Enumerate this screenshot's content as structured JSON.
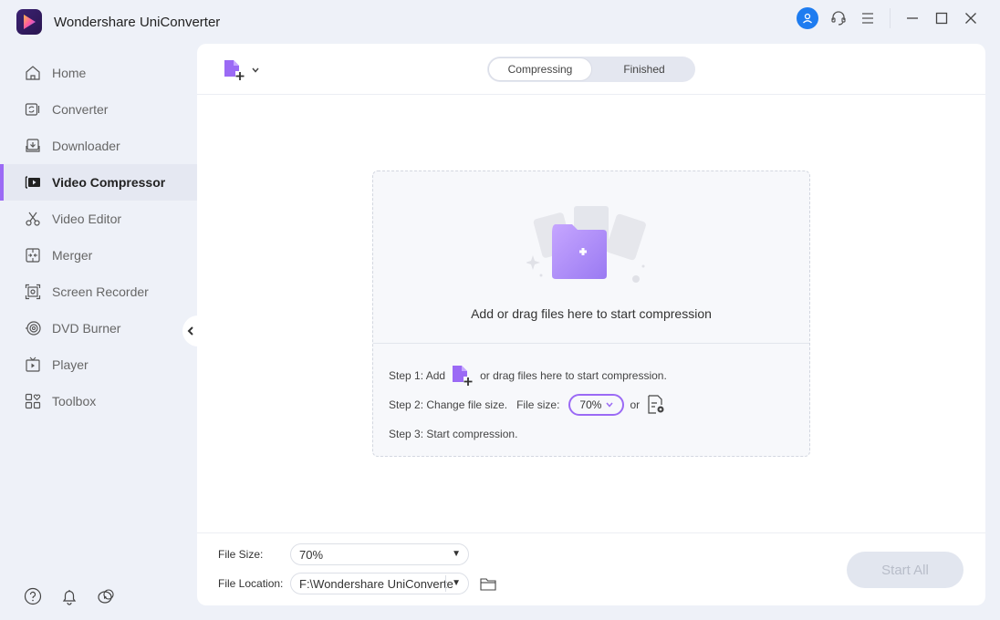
{
  "app": {
    "title": "Wondershare UniConverter",
    "logo_icon": "uniconverter-logo-icon"
  },
  "window_controls": {
    "account_icon": "user-icon",
    "support_icon": "headset-icon",
    "menu_icon": "hamburger-menu-icon",
    "minimize_icon": "minimize-icon",
    "maximize_icon": "maximize-icon",
    "close_icon": "close-icon"
  },
  "sidebar": {
    "items": [
      {
        "label": "Home",
        "icon": "home-icon",
        "active": false
      },
      {
        "label": "Converter",
        "icon": "converter-icon",
        "active": false
      },
      {
        "label": "Downloader",
        "icon": "downloader-icon",
        "active": false
      },
      {
        "label": "Video Compressor",
        "icon": "video-compressor-icon",
        "active": true
      },
      {
        "label": "Video Editor",
        "icon": "scissors-icon",
        "active": false
      },
      {
        "label": "Merger",
        "icon": "merger-icon",
        "active": false
      },
      {
        "label": "Screen Recorder",
        "icon": "screen-recorder-icon",
        "active": false
      },
      {
        "label": "DVD Burner",
        "icon": "dvd-icon",
        "active": false
      },
      {
        "label": "Player",
        "icon": "player-icon",
        "active": false
      },
      {
        "label": "Toolbox",
        "icon": "toolbox-icon",
        "active": false
      }
    ],
    "bottom_icons": [
      "help-icon",
      "bell-icon",
      "community-icon"
    ]
  },
  "main": {
    "tabs": [
      {
        "label": "Compressing",
        "active": true
      },
      {
        "label": "Finished",
        "active": false
      }
    ],
    "dropzone": {
      "text": "Add or drag files here to start compression"
    },
    "steps": {
      "step1_prefix": "Step 1: Add",
      "step1_suffix": "or drag files here to start compression.",
      "step2_prefix": "Step 2: Change file size.",
      "step2_file_size_label": "File size:",
      "step2_value": "70%",
      "step2_or": "or",
      "step3": "Step 3: Start compression."
    },
    "bottom": {
      "file_size_label": "File Size:",
      "file_size_value": "70%",
      "file_location_label": "File Location:",
      "file_location_value": "F:\\Wondershare UniConverte",
      "start_all_label": "Start All"
    },
    "accent_color": "#9b6af5"
  }
}
